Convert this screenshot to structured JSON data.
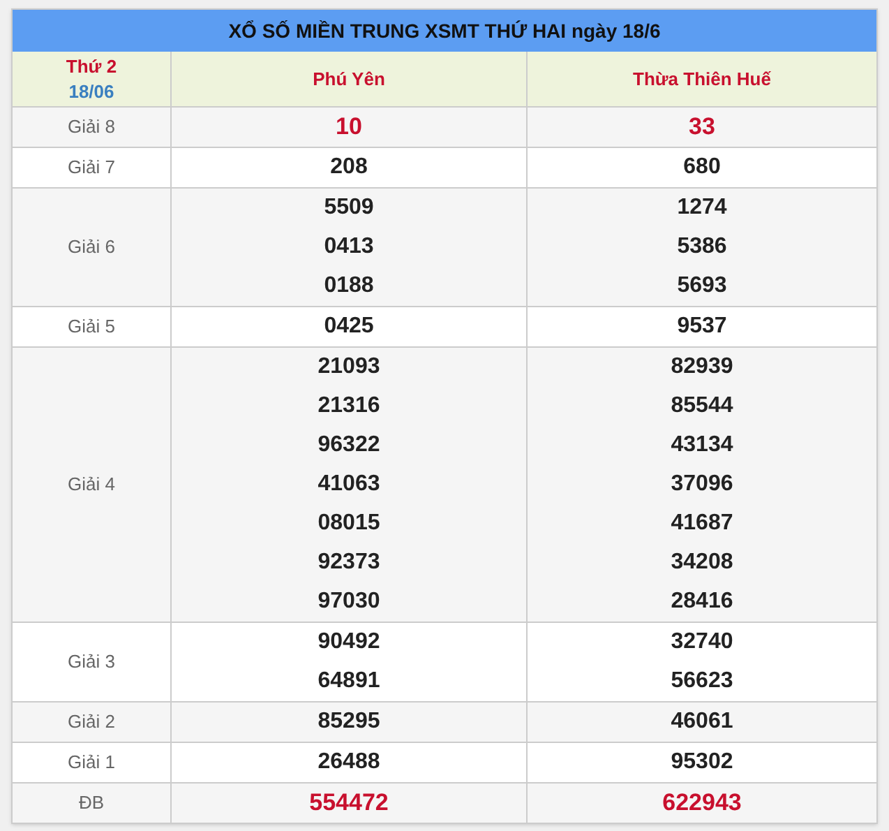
{
  "title": "XỔ SỐ MIỀN TRUNG XSMT THỨ HAI ngày 18/6",
  "header": {
    "day": "Thứ 2",
    "date": "18/06",
    "provinces": [
      "Phú Yên",
      "Thừa Thiên Huế"
    ]
  },
  "prizes": [
    {
      "label": "Giải 8",
      "kind": "special",
      "results": [
        [
          "10"
        ],
        [
          "33"
        ]
      ]
    },
    {
      "label": "Giải 7",
      "kind": "normal",
      "results": [
        [
          "208"
        ],
        [
          "680"
        ]
      ]
    },
    {
      "label": "Giải 6",
      "kind": "normal",
      "results": [
        [
          "5509",
          "0413",
          "0188"
        ],
        [
          "1274",
          "5386",
          "5693"
        ]
      ]
    },
    {
      "label": "Giải 5",
      "kind": "normal",
      "results": [
        [
          "0425"
        ],
        [
          "9537"
        ]
      ]
    },
    {
      "label": "Giải 4",
      "kind": "normal",
      "results": [
        [
          "21093",
          "21316",
          "96322",
          "41063",
          "08015",
          "92373",
          "97030"
        ],
        [
          "82939",
          "85544",
          "43134",
          "37096",
          "41687",
          "34208",
          "28416"
        ]
      ]
    },
    {
      "label": "Giải 3",
      "kind": "normal",
      "results": [
        [
          "90492",
          "64891"
        ],
        [
          "32740",
          "56623"
        ]
      ]
    },
    {
      "label": "Giải 2",
      "kind": "normal",
      "results": [
        [
          "85295"
        ],
        [
          "46061"
        ]
      ]
    },
    {
      "label": "Giải 1",
      "kind": "normal",
      "results": [
        [
          "26488"
        ],
        [
          "95302"
        ]
      ]
    },
    {
      "label": "ĐB",
      "kind": "special",
      "results": [
        [
          "554472"
        ],
        [
          "622943"
        ]
      ]
    }
  ]
}
